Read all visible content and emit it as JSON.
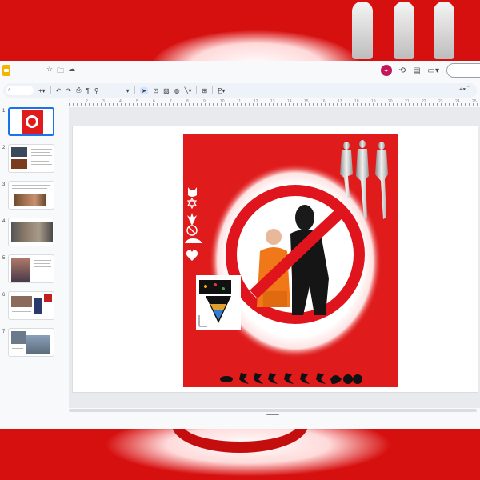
{
  "window": {
    "title": "",
    "title_icons": [
      "star-icon",
      "folder-move-icon",
      "cloud-saved-icon"
    ]
  },
  "header": {
    "right_icons": [
      "gemini-icon",
      "history-icon",
      "comments-icon",
      "meet-icon"
    ]
  },
  "toolbar": {
    "search_placeholder": "",
    "tools": [
      "add-icon",
      "undo-icon",
      "redo-icon",
      "print-icon",
      "paint-format-icon",
      "zoom-icon",
      "select-icon",
      "textbox-icon",
      "image-icon",
      "shape-icon",
      "line-icon",
      "comment-icon",
      "text-style-icon"
    ],
    "right_tools": [
      "cursor-icon",
      "collapse-icon"
    ]
  },
  "ruler": {
    "labels": [
      "1",
      "2",
      "3",
      "4",
      "5",
      "6",
      "7",
      "8",
      "9",
      "10",
      "11",
      "12",
      "13",
      "14",
      "15",
      "16",
      "17",
      "18",
      "19",
      "20",
      "21",
      "22",
      "23",
      "24",
      "25"
    ]
  },
  "filmstrip": {
    "slides": [
      {
        "number": "1",
        "selected": true
      },
      {
        "number": "2",
        "selected": false
      },
      {
        "number": "3",
        "selected": false
      },
      {
        "number": "4",
        "selected": false
      },
      {
        "number": "5",
        "selected": false
      },
      {
        "number": "6",
        "selected": false
      },
      {
        "number": "7",
        "selected": false
      }
    ]
  },
  "slide": {
    "poster": {
      "background_color": "#df1b1b",
      "prohibition_color": "#e0141c",
      "left_icons": [
        "cat-icon",
        "star-of-david-icon",
        "lily-icon",
        "no-smoking-icon",
        "car-icon",
        "heart-icon"
      ],
      "bottom_icons": [
        "crawling-figure-icon",
        "running-figure-icon",
        "running-figure-icon",
        "running-figure-icon",
        "running-figure-icon",
        "running-figure-icon",
        "running-figure-icon",
        "pot-icon",
        "bowl-icon",
        "bowl-icon"
      ],
      "figures": [
        "orange-robed-person",
        "black-clad-person"
      ],
      "mannequins": 3
    }
  },
  "colors": {
    "accent": "#1a73e8",
    "background_red": "#d60f0f",
    "app_bg": "#f8f9fa",
    "toolbar_bg": "#eef2f9"
  }
}
